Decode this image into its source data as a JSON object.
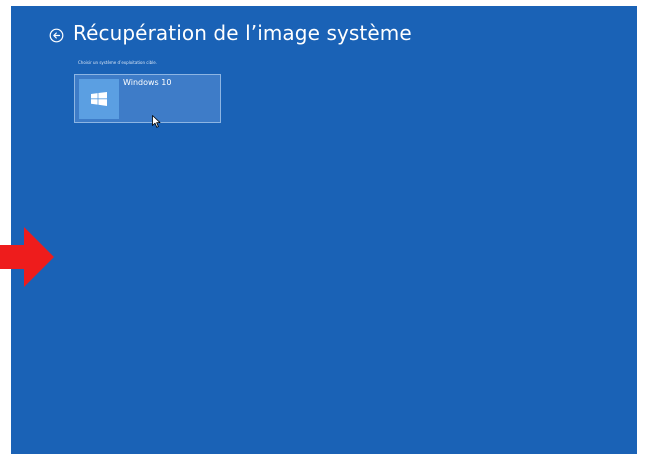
{
  "screen": {
    "background_color": "#1a62b6",
    "back_icon": "back-arrow-circle-icon",
    "title": "Récupération de l’image système",
    "subtitle": "Choisir un système d’exploitation cible."
  },
  "os_list": [
    {
      "name": "Windows 10",
      "icon": "windows-logo-icon",
      "selected": true
    }
  ],
  "overlay": {
    "arrow_icon": "red-arrow-icon",
    "arrow_color": "#ee1c1c",
    "cursor_icon": "mouse-pointer-icon"
  }
}
